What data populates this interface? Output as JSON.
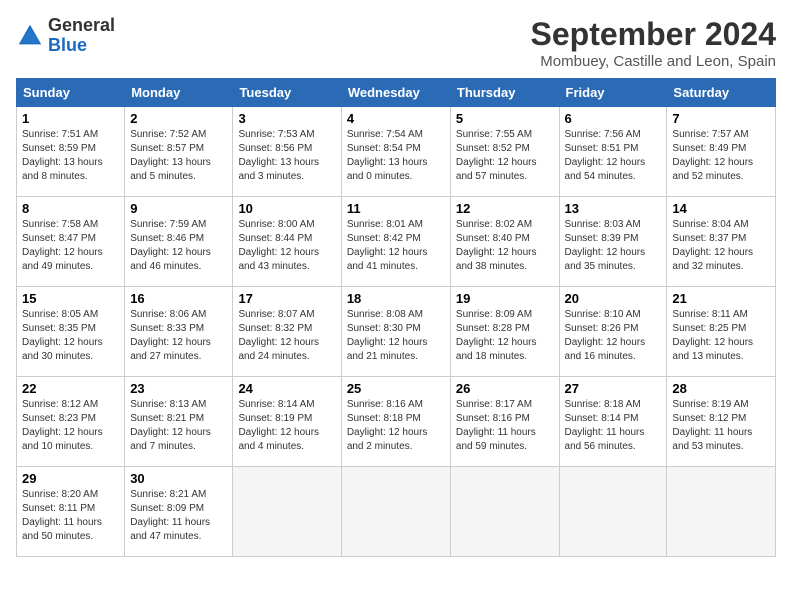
{
  "logo": {
    "text_general": "General",
    "text_blue": "Blue"
  },
  "header": {
    "month_title": "September 2024",
    "subtitle": "Mombuey, Castille and Leon, Spain"
  },
  "weekdays": [
    "Sunday",
    "Monday",
    "Tuesday",
    "Wednesday",
    "Thursday",
    "Friday",
    "Saturday"
  ],
  "weeks": [
    [
      {
        "day": "1",
        "sunrise": "Sunrise: 7:51 AM",
        "sunset": "Sunset: 8:59 PM",
        "daylight": "Daylight: 13 hours and 8 minutes."
      },
      {
        "day": "2",
        "sunrise": "Sunrise: 7:52 AM",
        "sunset": "Sunset: 8:57 PM",
        "daylight": "Daylight: 13 hours and 5 minutes."
      },
      {
        "day": "3",
        "sunrise": "Sunrise: 7:53 AM",
        "sunset": "Sunset: 8:56 PM",
        "daylight": "Daylight: 13 hours and 3 minutes."
      },
      {
        "day": "4",
        "sunrise": "Sunrise: 7:54 AM",
        "sunset": "Sunset: 8:54 PM",
        "daylight": "Daylight: 13 hours and 0 minutes."
      },
      {
        "day": "5",
        "sunrise": "Sunrise: 7:55 AM",
        "sunset": "Sunset: 8:52 PM",
        "daylight": "Daylight: 12 hours and 57 minutes."
      },
      {
        "day": "6",
        "sunrise": "Sunrise: 7:56 AM",
        "sunset": "Sunset: 8:51 PM",
        "daylight": "Daylight: 12 hours and 54 minutes."
      },
      {
        "day": "7",
        "sunrise": "Sunrise: 7:57 AM",
        "sunset": "Sunset: 8:49 PM",
        "daylight": "Daylight: 12 hours and 52 minutes."
      }
    ],
    [
      {
        "day": "8",
        "sunrise": "Sunrise: 7:58 AM",
        "sunset": "Sunset: 8:47 PM",
        "daylight": "Daylight: 12 hours and 49 minutes."
      },
      {
        "day": "9",
        "sunrise": "Sunrise: 7:59 AM",
        "sunset": "Sunset: 8:46 PM",
        "daylight": "Daylight: 12 hours and 46 minutes."
      },
      {
        "day": "10",
        "sunrise": "Sunrise: 8:00 AM",
        "sunset": "Sunset: 8:44 PM",
        "daylight": "Daylight: 12 hours and 43 minutes."
      },
      {
        "day": "11",
        "sunrise": "Sunrise: 8:01 AM",
        "sunset": "Sunset: 8:42 PM",
        "daylight": "Daylight: 12 hours and 41 minutes."
      },
      {
        "day": "12",
        "sunrise": "Sunrise: 8:02 AM",
        "sunset": "Sunset: 8:40 PM",
        "daylight": "Daylight: 12 hours and 38 minutes."
      },
      {
        "day": "13",
        "sunrise": "Sunrise: 8:03 AM",
        "sunset": "Sunset: 8:39 PM",
        "daylight": "Daylight: 12 hours and 35 minutes."
      },
      {
        "day": "14",
        "sunrise": "Sunrise: 8:04 AM",
        "sunset": "Sunset: 8:37 PM",
        "daylight": "Daylight: 12 hours and 32 minutes."
      }
    ],
    [
      {
        "day": "15",
        "sunrise": "Sunrise: 8:05 AM",
        "sunset": "Sunset: 8:35 PM",
        "daylight": "Daylight: 12 hours and 30 minutes."
      },
      {
        "day": "16",
        "sunrise": "Sunrise: 8:06 AM",
        "sunset": "Sunset: 8:33 PM",
        "daylight": "Daylight: 12 hours and 27 minutes."
      },
      {
        "day": "17",
        "sunrise": "Sunrise: 8:07 AM",
        "sunset": "Sunset: 8:32 PM",
        "daylight": "Daylight: 12 hours and 24 minutes."
      },
      {
        "day": "18",
        "sunrise": "Sunrise: 8:08 AM",
        "sunset": "Sunset: 8:30 PM",
        "daylight": "Daylight: 12 hours and 21 minutes."
      },
      {
        "day": "19",
        "sunrise": "Sunrise: 8:09 AM",
        "sunset": "Sunset: 8:28 PM",
        "daylight": "Daylight: 12 hours and 18 minutes."
      },
      {
        "day": "20",
        "sunrise": "Sunrise: 8:10 AM",
        "sunset": "Sunset: 8:26 PM",
        "daylight": "Daylight: 12 hours and 16 minutes."
      },
      {
        "day": "21",
        "sunrise": "Sunrise: 8:11 AM",
        "sunset": "Sunset: 8:25 PM",
        "daylight": "Daylight: 12 hours and 13 minutes."
      }
    ],
    [
      {
        "day": "22",
        "sunrise": "Sunrise: 8:12 AM",
        "sunset": "Sunset: 8:23 PM",
        "daylight": "Daylight: 12 hours and 10 minutes."
      },
      {
        "day": "23",
        "sunrise": "Sunrise: 8:13 AM",
        "sunset": "Sunset: 8:21 PM",
        "daylight": "Daylight: 12 hours and 7 minutes."
      },
      {
        "day": "24",
        "sunrise": "Sunrise: 8:14 AM",
        "sunset": "Sunset: 8:19 PM",
        "daylight": "Daylight: 12 hours and 4 minutes."
      },
      {
        "day": "25",
        "sunrise": "Sunrise: 8:16 AM",
        "sunset": "Sunset: 8:18 PM",
        "daylight": "Daylight: 12 hours and 2 minutes."
      },
      {
        "day": "26",
        "sunrise": "Sunrise: 8:17 AM",
        "sunset": "Sunset: 8:16 PM",
        "daylight": "Daylight: 11 hours and 59 minutes."
      },
      {
        "day": "27",
        "sunrise": "Sunrise: 8:18 AM",
        "sunset": "Sunset: 8:14 PM",
        "daylight": "Daylight: 11 hours and 56 minutes."
      },
      {
        "day": "28",
        "sunrise": "Sunrise: 8:19 AM",
        "sunset": "Sunset: 8:12 PM",
        "daylight": "Daylight: 11 hours and 53 minutes."
      }
    ],
    [
      {
        "day": "29",
        "sunrise": "Sunrise: 8:20 AM",
        "sunset": "Sunset: 8:11 PM",
        "daylight": "Daylight: 11 hours and 50 minutes."
      },
      {
        "day": "30",
        "sunrise": "Sunrise: 8:21 AM",
        "sunset": "Sunset: 8:09 PM",
        "daylight": "Daylight: 11 hours and 47 minutes."
      },
      null,
      null,
      null,
      null,
      null
    ]
  ]
}
